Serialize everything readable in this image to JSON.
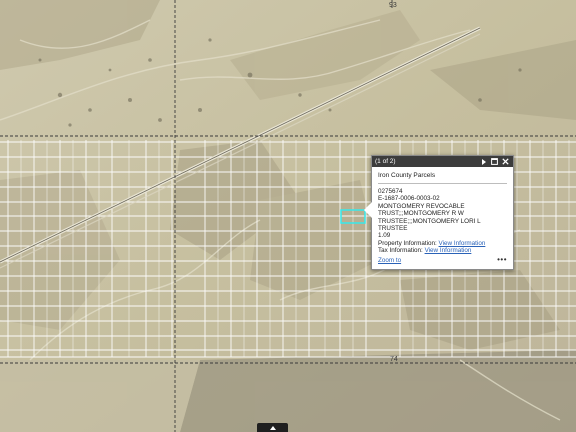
{
  "map": {
    "road_labels": [
      "93",
      "74"
    ],
    "colors": {
      "terrain": "#c9c2a6",
      "parcel_lines": "#ffffff",
      "boundary_dash": "#3a3a3a",
      "selection": "#3ee6e6"
    }
  },
  "popup": {
    "counter": "(1 of 2)",
    "icons": [
      "next-arrow-icon",
      "maximize-icon",
      "close-icon"
    ],
    "layer_title": "Iron County Parcels",
    "lines": [
      "0275674",
      "E-1687-0006-0003-02",
      "MONTGOMERY REVOCABLE",
      "TRUST;;;MONTGOMERY R W",
      "TRUSTEE;;;MONTGOMERY LORI L TRUSTEE",
      "1.09"
    ],
    "property_label": "Property Information:",
    "property_link": "View Information",
    "tax_label": "Tax Information:",
    "tax_link": "View Information",
    "zoom_to": "Zoom to",
    "more": "•••"
  },
  "bottom_tab": {
    "icon": "chevron-up-icon"
  }
}
